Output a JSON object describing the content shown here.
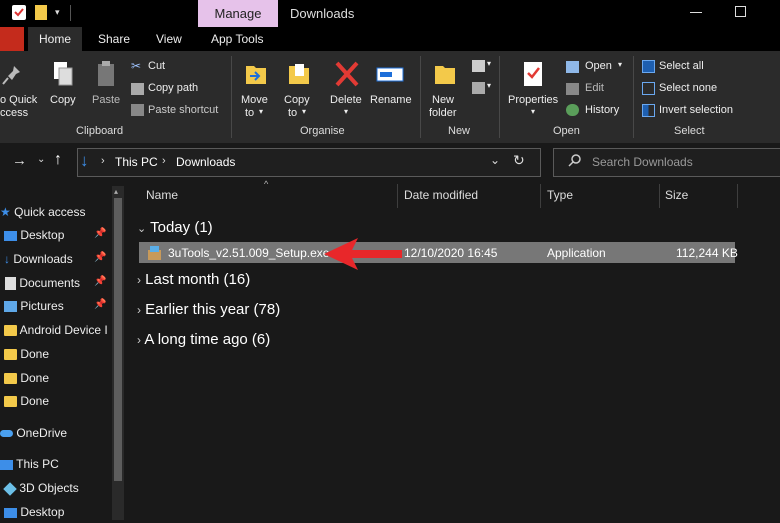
{
  "window": {
    "title": "Downloads",
    "context_tab": "Manage"
  },
  "ribbon": {
    "tabs": [
      {
        "label": "Home"
      },
      {
        "label": "Share"
      },
      {
        "label": "View"
      },
      {
        "label": "App Tools"
      }
    ],
    "clipboard": {
      "quick_access_line1": "o Quick",
      "quick_access_line2": "ccess",
      "copy": "Copy",
      "paste": "Paste",
      "cut": "Cut",
      "copy_path": "Copy path",
      "paste_shortcut": "Paste shortcut",
      "group_label": "Clipboard"
    },
    "organise": {
      "move_to_line1": "Move",
      "move_to_line2": "to",
      "copy_to_line1": "Copy",
      "copy_to_line2": "to",
      "delete": "Delete",
      "rename": "Rename",
      "group_label": "Organise"
    },
    "new": {
      "new_folder_line1": "New",
      "new_folder_line2": "folder",
      "group_label": "New"
    },
    "open": {
      "properties": "Properties",
      "open": "Open",
      "edit": "Edit",
      "history": "History",
      "group_label": "Open"
    },
    "select": {
      "select_all": "Select all",
      "select_none": "Select none",
      "invert_selection": "Invert selection",
      "group_label": "Select"
    }
  },
  "address": {
    "path": [
      "This PC",
      "Downloads"
    ],
    "search_placeholder": "Search Downloads"
  },
  "nav": {
    "quick_access": "Quick access",
    "items": [
      {
        "label": "Desktop",
        "icon": "desktop-icon",
        "pinned": true
      },
      {
        "label": "Downloads",
        "icon": "download-icon",
        "pinned": true
      },
      {
        "label": "Documents",
        "icon": "documents-icon",
        "pinned": true
      },
      {
        "label": "Pictures",
        "icon": "pictures-icon",
        "pinned": true
      },
      {
        "label": "Android Device I",
        "icon": "folder-icon",
        "pinned": false
      },
      {
        "label": "Done",
        "icon": "folder-icon",
        "pinned": false
      },
      {
        "label": "Done",
        "icon": "folder-icon",
        "pinned": false
      },
      {
        "label": "Done",
        "icon": "folder-icon",
        "pinned": false
      }
    ],
    "onedrive": "OneDrive",
    "this_pc": "This PC",
    "objects3d": "3D Objects",
    "desktop2": "Desktop"
  },
  "columns": {
    "name": "Name",
    "date_modified": "Date modified",
    "type": "Type",
    "size": "Size"
  },
  "groups": [
    {
      "label": "Today (1)",
      "expanded": true
    },
    {
      "label": "Last month (16)",
      "expanded": false
    },
    {
      "label": "Earlier this year (78)",
      "expanded": false
    },
    {
      "label": "A long time ago (6)",
      "expanded": false
    }
  ],
  "file": {
    "name": "3uTools_v2.51.009_Setup.exe",
    "date": "12/10/2020 16:45",
    "type": "Application",
    "size": "112,244 KB"
  },
  "colors": {
    "accent": "#1e90ff",
    "manage_tab": "#e6c2ea",
    "file_tab": "#c42b1c",
    "arrow": "#e8272a",
    "selection": "#777777"
  }
}
